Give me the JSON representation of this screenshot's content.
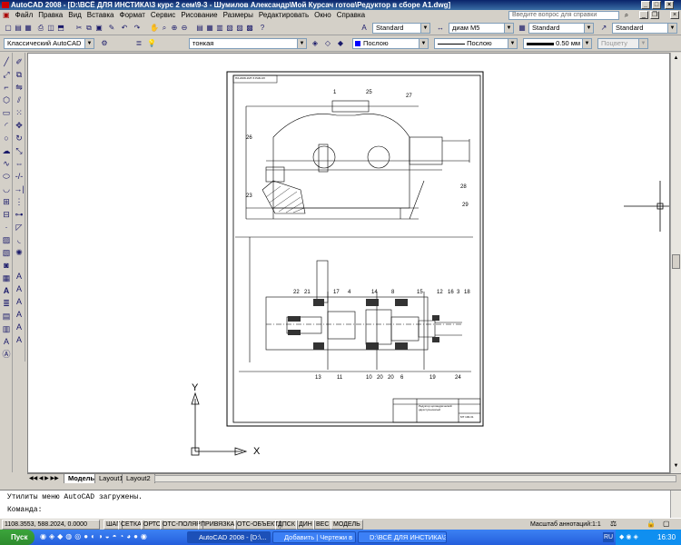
{
  "window": {
    "title": "AutoCAD 2008 - [D:\\ВСЁ ДЛЯ ИНСТИКА\\3 курс 2 сем\\9-3 - Шумилов Александр\\Мой Курсач готов\\Редуктор в сборе А1.dwg]",
    "minimize": "_",
    "maximize": "□",
    "close": "×"
  },
  "menu": {
    "items": [
      "Файл",
      "Правка",
      "Вид",
      "Вставка",
      "Формат",
      "Сервис",
      "Рисование",
      "Размеры",
      "Редактировать",
      "Окно",
      "Справка"
    ],
    "help_placeholder": "Введите вопрос для справки"
  },
  "toolbar": {
    "text_style": "Standard",
    "dim_style": "диам М5",
    "table_style": "Standard",
    "mleader_style": "Standard",
    "workspace": "Классический AutoCAD",
    "layer": "тонкая",
    "color": "Послою",
    "linetype": "Послою",
    "lineweight": "0.50 мм",
    "plotstyle": "Поцвету"
  },
  "drawing": {
    "title_block_text": "ПЗ-2008-1МТ-5 РАБ-ЗЛ",
    "title_block_name": "Редуктор цилиндрический двухступенчатый",
    "title_block_code": "МТ 100-31",
    "part_labels_top": [
      "1",
      "25",
      "27",
      "26",
      "28",
      "29",
      "23"
    ],
    "part_labels_bottom": [
      "22",
      "21",
      "17",
      "4",
      "14",
      "8",
      "15",
      "12",
      "16",
      "3",
      "18",
      "13",
      "11",
      "10",
      "20",
      "20",
      "6",
      "19",
      "24"
    ],
    "ucs_x": "X",
    "ucs_y": "Y"
  },
  "tabs": [
    "Модель",
    "Layout1",
    "Layout2"
  ],
  "command": {
    "line1": "Утилиты меню AutoCAD загружены.",
    "line2": "Команда:"
  },
  "status": {
    "coords": "1108.3553, 588.2024, 0.0000",
    "buttons": [
      "ШАГ",
      "СЕТКА",
      "ОРТО",
      "ОТС-ПОЛЯР",
      "ПРИВЯЗКА",
      "ОТС-ОБЪЕКТ",
      "ДПСК",
      "ДИН",
      "ВЕС",
      "МОДЕЛЬ"
    ],
    "annotation_scale_label": "Масштаб аннотаций:",
    "annotation_scale": "1:1"
  },
  "taskbar": {
    "start": "Пуск",
    "tasks": [
      "AutoCAD 2008 - [D:\\...",
      "Добавить | Чертежи в ...",
      "D:\\ВСЁ ДЛЯ ИНСТИКА\\3..."
    ],
    "lang": "RU",
    "time": "16:30"
  }
}
